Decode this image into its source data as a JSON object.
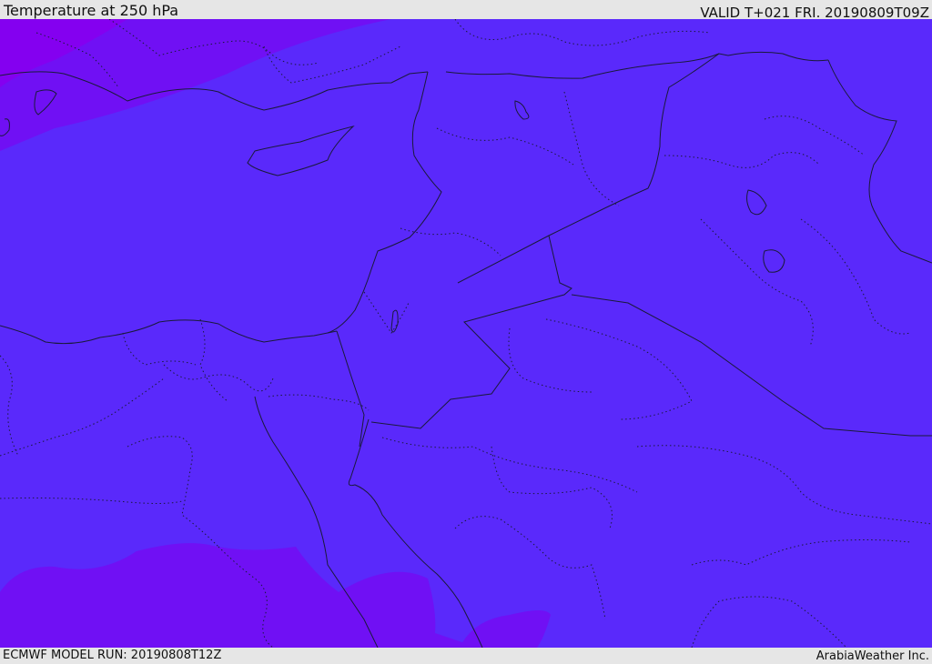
{
  "header": {
    "title": "Temperature at 250 hPa",
    "valid": "VALID T+021 FRI. 20190809T09Z"
  },
  "footer": {
    "model_run": "ECMWF MODEL RUN: 20190808T12Z",
    "credit": "ArabiaWeather Inc."
  },
  "map": {
    "colors": {
      "main_field": "#5a29fb",
      "cool_field": "#7010f4",
      "coldest_field": "#8400f0",
      "borders": "#1a1a3a"
    },
    "regions": [
      "main-temperature-band",
      "cool-band-northwest",
      "cool-band-south",
      "cool-band-southeast"
    ]
  }
}
